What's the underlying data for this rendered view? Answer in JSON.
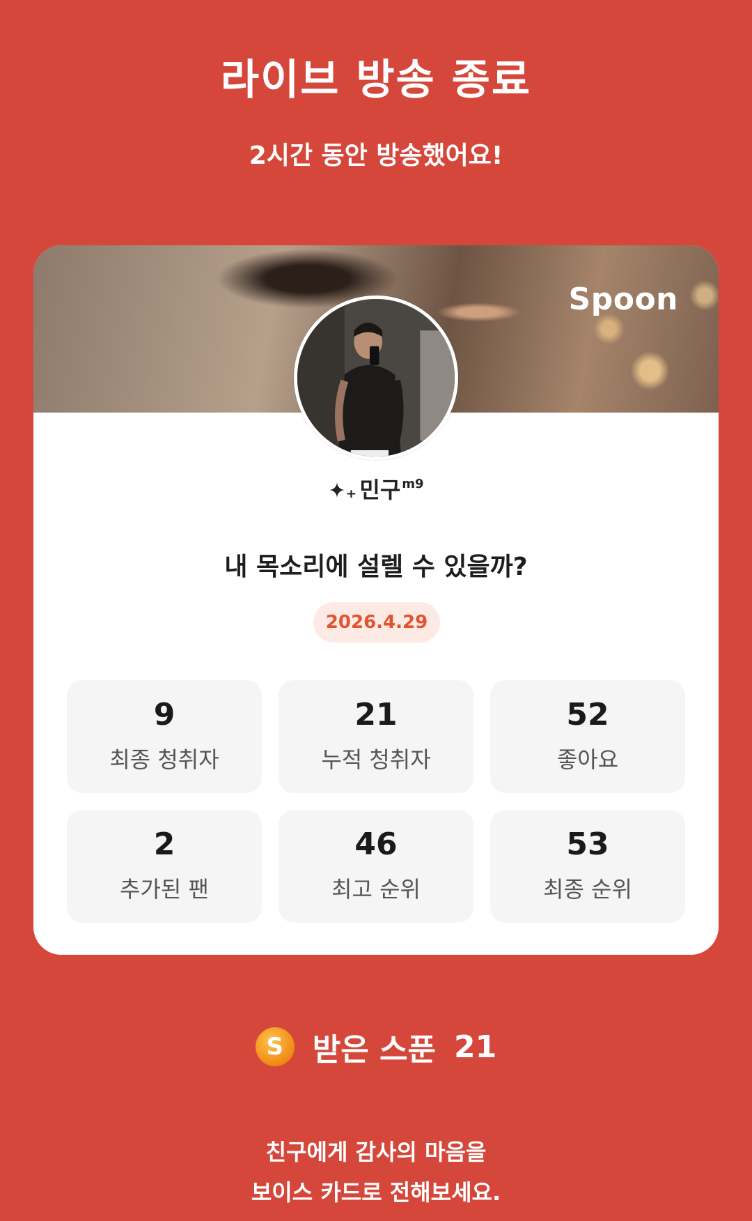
{
  "header": {
    "title": "라이브 방송 종료",
    "subtitle": "2시간 동안 방송했어요!"
  },
  "card": {
    "brand": "Spoon",
    "nickname": {
      "prefix": "✦₊",
      "name": "민구",
      "suffix": "m9"
    },
    "live_title": "내 목소리에 설렐 수 있을까?",
    "date": "2026.4.29",
    "stats": [
      {
        "value": "9",
        "label": "최종 청취자"
      },
      {
        "value": "21",
        "label": "누적 청취자"
      },
      {
        "value": "52",
        "label": "좋아요"
      },
      {
        "value": "2",
        "label": "추가된 팬"
      },
      {
        "value": "46",
        "label": "최고 순위"
      },
      {
        "value": "53",
        "label": "최종 순위"
      }
    ]
  },
  "spoons": {
    "icon": "spoon-coin-icon",
    "coin_letter": "S",
    "label": "받은 스푼",
    "count": "21"
  },
  "cta": {
    "line1": "친구에게 감사의 마음을",
    "line2": "보이스 카드로 전해보세요."
  },
  "colors": {
    "background": "#d6473b",
    "date_text": "#e1542f",
    "date_bg": "#fdeae4"
  }
}
